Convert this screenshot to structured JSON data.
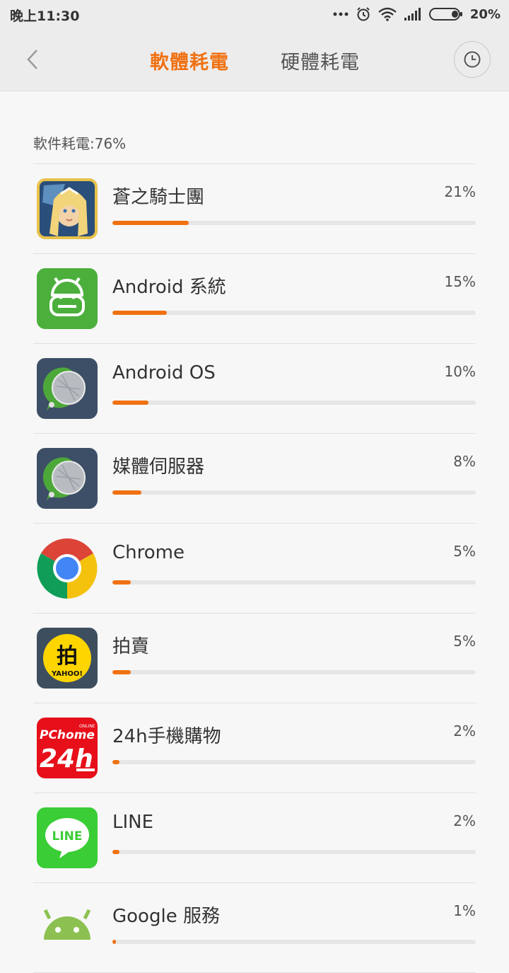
{
  "status_bar": {
    "time": "晚上11:30",
    "battery": "20%"
  },
  "header": {
    "tabs": [
      {
        "label": "軟體耗電",
        "active": true
      },
      {
        "label": "硬體耗電",
        "active": false
      }
    ]
  },
  "summary": "軟件耗電:76%",
  "apps": [
    {
      "name": "蒼之騎士團",
      "percent": "21%",
      "level": 0.21,
      "icon": "game-character-icon"
    },
    {
      "name": "Android 系統",
      "percent": "15%",
      "level": 0.15,
      "icon": "android-system-icon"
    },
    {
      "name": "Android OS",
      "percent": "10%",
      "level": 0.1,
      "icon": "android-os-icon"
    },
    {
      "name": "媒體伺服器",
      "percent": "8%",
      "level": 0.08,
      "icon": "media-server-icon"
    },
    {
      "name": "Chrome",
      "percent": "5%",
      "level": 0.05,
      "icon": "chrome-icon"
    },
    {
      "name": "拍賣",
      "percent": "5%",
      "level": 0.05,
      "icon": "yahoo-auction-icon"
    },
    {
      "name": "24h手機購物",
      "percent": "2%",
      "level": 0.02,
      "icon": "pchome-24h-icon"
    },
    {
      "name": "LINE",
      "percent": "2%",
      "level": 0.02,
      "icon": "line-icon"
    },
    {
      "name": "Google 服務",
      "percent": "1%",
      "level": 0.01,
      "icon": "google-services-icon"
    }
  ],
  "icon_text": {
    "yahoo_glyph": "拍",
    "yahoo_word": "YAHOO!",
    "pchome_top": "PChome",
    "pchome_online": "ONLINE",
    "pchome_24h": "24h",
    "line_word": "LINE"
  },
  "colors": {
    "accent": "#f07112",
    "track": "#e6e6e6",
    "background": "#f7f7f7"
  }
}
